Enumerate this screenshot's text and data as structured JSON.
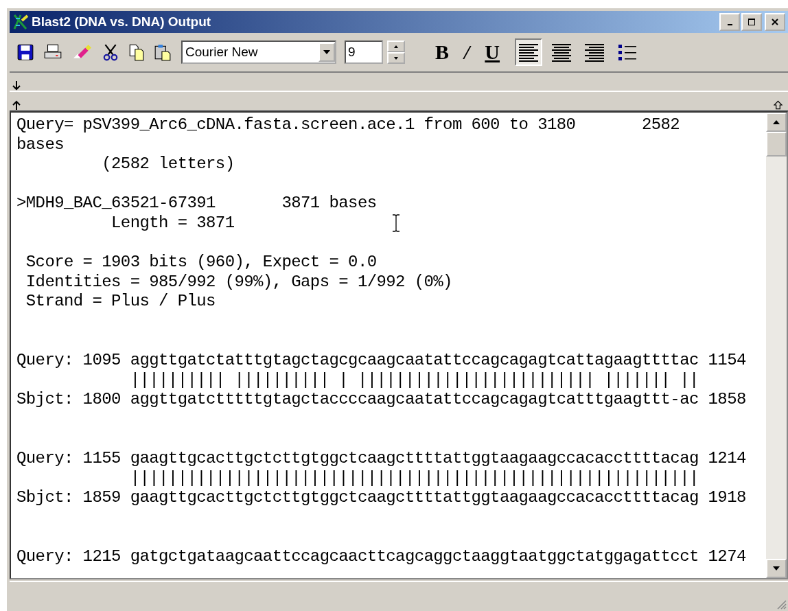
{
  "window": {
    "title": "Blast2  (DNA vs. DNA) Output"
  },
  "toolbar": {
    "font": "Courier New",
    "size": "9",
    "format_buttons": [
      {
        "label": "B",
        "kind": "bold"
      },
      {
        "label": "/",
        "kind": "italic"
      },
      {
        "label": "U",
        "kind": "underline"
      }
    ],
    "align_buttons": [
      {
        "kind": "left",
        "selected": true
      },
      {
        "kind": "center",
        "selected": false
      },
      {
        "kind": "right",
        "selected": false
      }
    ]
  },
  "document": {
    "blocks": [
      {
        "kind": "header",
        "lines": [
          "Query= pSV399_Arc6_cDNA.fasta.screen.ace.1 from 600 to 3180       2582",
          "bases",
          "         (2582 letters)"
        ]
      },
      {
        "kind": "header",
        "lines": [
          ">MDH9_BAC_63521-67391       3871 bases",
          "          Length = 3871"
        ]
      },
      {
        "kind": "header",
        "lines": [
          " Score = 1903 bits (960), Expect = 0.0",
          " Identities = 985/992 (99%), Gaps = 1/992 (0%)",
          " Strand = Plus / Plus"
        ]
      },
      {
        "kind": "alignment",
        "lines": [
          "Query: 1095 aggttgatctatttgtagctagcgcaagcaatattccagcagagtcattagaagttttac 1154",
          "            |||||||||| |||||||||| | ||||||||||||||||||||||||| ||||||| ||",
          "Sbjct: 1800 aggttgatctttttgtagctaccccaagcaatattccagcagagtcatttgaagttt-ac 1858"
        ]
      },
      {
        "kind": "alignment",
        "lines": [
          "Query: 1155 gaagttgcacttgctcttgtggctcaagcttttattggtaagaagccacaccttttacag 1214",
          "            ||||||||||||||||||||||||||||||||||||||||||||||||||||||||||||",
          "Sbjct: 1859 gaagttgcacttgctcttgtggctcaagcttttattggtaagaagccacaccttttacag 1918"
        ]
      },
      {
        "kind": "alignment",
        "lines": [
          "Query: 1215 gatgctgataagcaattccagcaacttcagcaggctaaggtaatggctatggagattcct 1274"
        ]
      }
    ]
  }
}
